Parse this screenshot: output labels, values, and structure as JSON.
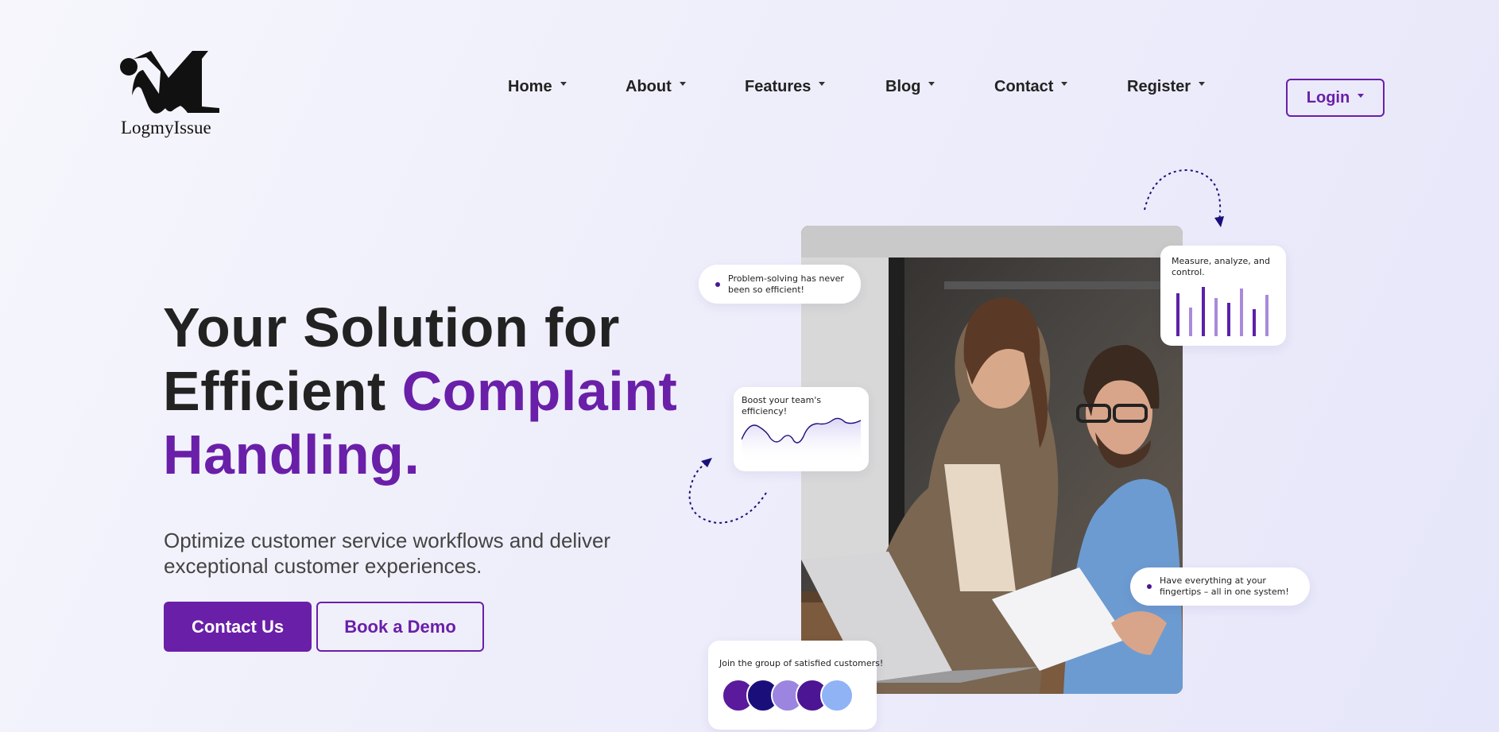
{
  "brand": {
    "name": "LogmyIssue"
  },
  "nav": {
    "items": [
      {
        "label": "Home"
      },
      {
        "label": "About"
      },
      {
        "label": "Features"
      },
      {
        "label": "Blog"
      },
      {
        "label": "Contact"
      },
      {
        "label": "Register"
      }
    ],
    "login_label": "Login"
  },
  "hero": {
    "title_line1": "Your Solution for",
    "title_line2_plain": "Efficient ",
    "title_line2_accent": "Complaint",
    "title_line3_accent": "Handling.",
    "subtitle": "Optimize customer service workflows and deliver exceptional customer experiences.",
    "primary_button": "Contact Us",
    "secondary_button": "Book a Demo"
  },
  "cards": {
    "problem": "Problem-solving has never been so efficient!",
    "measure": "Measure, analyze, and control.",
    "boost": "Boost your team's efficiency!",
    "fingertips": "Have everything at your fingertips – all in one system!",
    "join": "Join the group of satisfied customers!"
  },
  "colors": {
    "accent": "#6a1fa8",
    "dark_purple": "#4b1593",
    "navy": "#1a0f7a",
    "lavender": "#9b85e0",
    "light_blue": "#8fb3f5"
  },
  "icons": {
    "nav_dropdown": "caret-down-icon",
    "curved_arrow": "dashed-curved-arrow-icon"
  }
}
